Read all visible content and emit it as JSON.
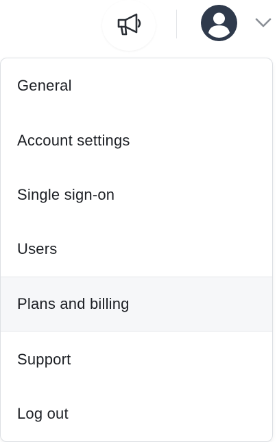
{
  "header": {
    "announcements_icon": "megaphone-icon",
    "avatar_icon": "user-avatar-icon",
    "menu_toggle_icon": "chevron-down-icon"
  },
  "menu": {
    "items": [
      {
        "label": "General"
      },
      {
        "label": "Account settings"
      },
      {
        "label": "Single sign-on"
      },
      {
        "label": "Users"
      },
      {
        "label": "Plans and billing"
      },
      {
        "label": "Support"
      },
      {
        "label": "Log out"
      }
    ],
    "highlighted_item": "Plans and billing"
  },
  "colors": {
    "avatar_bg": "#2f3a4c",
    "text": "#1c1f24",
    "highlight_bg": "#f6f7f9",
    "border": "#dcdfe3"
  }
}
